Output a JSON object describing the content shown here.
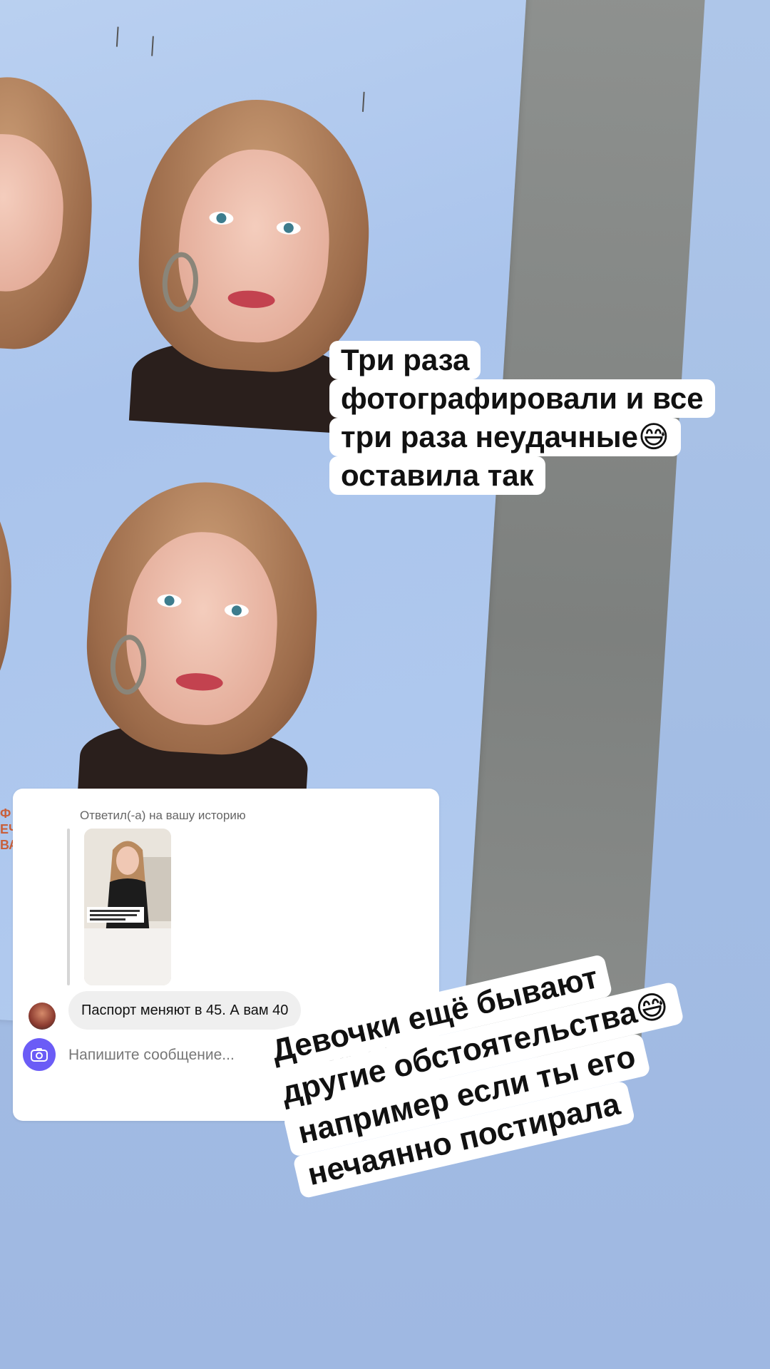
{
  "story": {
    "caption_top_lines": [
      "Три раза",
      "фотографировали и все",
      "три раза неудачные😅",
      "оставила так"
    ],
    "caption_bottom_lines": [
      "Девочки ещё бывают",
      "другие обстоятельства😅",
      "например если ты его",
      "нечаянно постирала"
    ],
    "side_fragment": [
      "Ф",
      "ЕЧ",
      "ВА"
    ]
  },
  "reply": {
    "header": "Ответил(-а) на вашу историю",
    "message": "Паспорт меняют в 45. А вам 40",
    "composer_placeholder": "Напишите сообщение..."
  },
  "icons": {
    "camera": "camera-icon",
    "mic": "microphone-icon",
    "gallery": "image-icon",
    "sticker": "sticker-icon",
    "add": "plus-circle-icon"
  },
  "colors": {
    "background": "#a7bfe3",
    "camera_button": "#6b5cf6",
    "bubble": "#efefef"
  }
}
